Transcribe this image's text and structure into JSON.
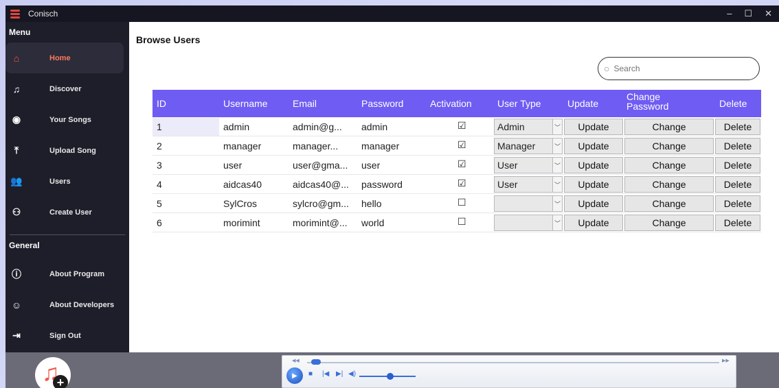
{
  "window": {
    "title": "Conisch",
    "controls": [
      "–",
      "☐",
      "✕"
    ]
  },
  "sidebar": {
    "menu_heading": "Menu",
    "menu_items": [
      {
        "label": "Home",
        "icon": "home-icon",
        "glyph": "⌂",
        "active": true
      },
      {
        "label": "Discover",
        "icon": "discover-icon",
        "glyph": "♫"
      },
      {
        "label": "Your Songs",
        "icon": "record-icon",
        "glyph": "◉"
      },
      {
        "label": "Upload Song",
        "icon": "upload-icon",
        "glyph": "⤒"
      },
      {
        "label": "Users",
        "icon": "users-icon",
        "glyph": "👥"
      },
      {
        "label": "Create User",
        "icon": "add-user-icon",
        "glyph": "⚇"
      }
    ],
    "general_heading": "General",
    "general_items": [
      {
        "label": "About Program",
        "icon": "info-icon",
        "glyph": "ⓘ"
      },
      {
        "label": "About Developers",
        "icon": "developers-icon",
        "glyph": "☺"
      },
      {
        "label": "Sign Out",
        "icon": "sign-out-icon",
        "glyph": "⇥"
      }
    ]
  },
  "main": {
    "title": "Browse Users",
    "search": {
      "placeholder": "Search",
      "value": ""
    },
    "columns": [
      "ID",
      "Username",
      "Email",
      "Password",
      "Activation",
      "User Type",
      "Update",
      "Change Password",
      "Delete"
    ],
    "rows": [
      {
        "id": "1",
        "username": "admin",
        "email": "admin@g...",
        "password": "admin",
        "activated": "☑",
        "user_type": "Admin",
        "update": "Update",
        "change": "Change",
        "delete": "Delete"
      },
      {
        "id": "2",
        "username": "manager",
        "email": "manager...",
        "password": "manager",
        "activated": "☑",
        "user_type": "Manager",
        "update": "Update",
        "change": "Change",
        "delete": "Delete"
      },
      {
        "id": "3",
        "username": "user",
        "email": "user@gma...",
        "password": "user",
        "activated": "☑",
        "user_type": "User",
        "update": "Update",
        "change": "Change",
        "delete": "Delete"
      },
      {
        "id": "4",
        "username": "aidcas40",
        "email": "aidcas40@...",
        "password": "password",
        "activated": "☑",
        "user_type": "User",
        "update": "Update",
        "change": "Change",
        "delete": "Delete"
      },
      {
        "id": "5",
        "username": "SylCros",
        "email": "sylcro@gm...",
        "password": "hello",
        "activated": "☐",
        "user_type": "",
        "update": "Update",
        "change": "Change",
        "delete": "Delete"
      },
      {
        "id": "6",
        "username": "morimint",
        "email": "morimint@...",
        "password": "world",
        "activated": "☐",
        "user_type": "",
        "update": "Update",
        "change": "Change",
        "delete": "Delete"
      }
    ]
  },
  "player": {
    "seek_fraction": 0.02,
    "volume_fraction": 0.55
  },
  "colors": {
    "accent": "#6f5cf2",
    "sidebar": "#1e1e2a",
    "active": "#ff5a3a"
  }
}
